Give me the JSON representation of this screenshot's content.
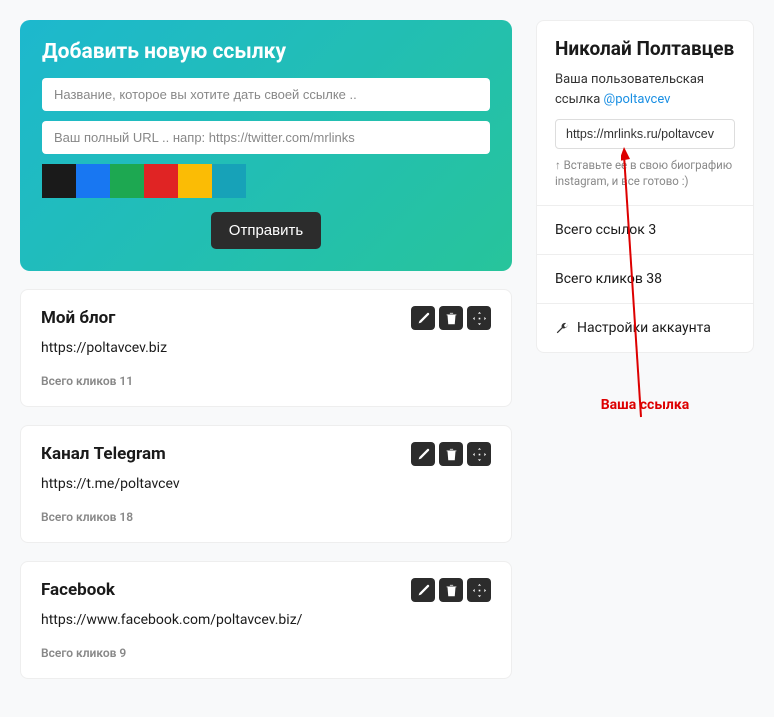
{
  "addForm": {
    "title": "Добавить новую ссылку",
    "namePlaceholder": "Название, которое вы хотите дать своей ссылке ..",
    "urlPlaceholder": "Ваш полный URL .. напр: https://twitter.com/mrlinks",
    "submit": "Отправить",
    "colors": [
      "#1a1a1a",
      "#1877F2",
      "#1DA851",
      "#E02424",
      "#FBBC05",
      "#17A2B8"
    ]
  },
  "links": [
    {
      "title": "Мой блог",
      "url": "https://poltavcev.biz",
      "clicksLabel": "Всего кликов 11"
    },
    {
      "title": "Канал Telegram",
      "url": "https://t.me/poltavcev",
      "clicksLabel": "Всего кликов 18"
    },
    {
      "title": "Facebook",
      "url": "https://www.facebook.com/poltavcev.biz/",
      "clicksLabel": "Всего кликов 9"
    }
  ],
  "profile": {
    "name": "Николай Полтавцев",
    "descPrefix": "Ваша пользовательская ссылка ",
    "handle": "@poltavcev",
    "linkValue": "https://mrlinks.ru/poltavcev",
    "hint": "↑ Вставьте ее в свою биографию instagram, и все готово :)",
    "totalLinks": "Всего ссылок 3",
    "totalClicks": "Всего кликов 38",
    "settings": "Настройки аккаунта"
  },
  "annotation": {
    "label": "Ваша ссылка"
  }
}
